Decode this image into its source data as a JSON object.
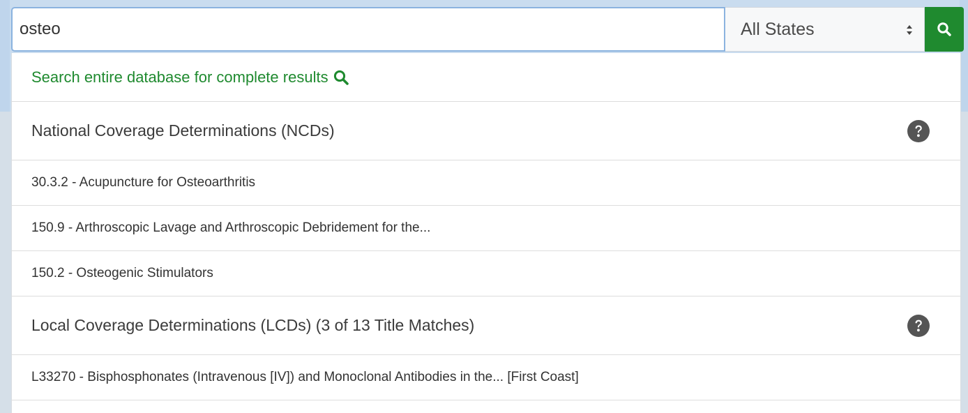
{
  "search": {
    "query": "osteo",
    "state_selected": "All States",
    "search_button_icon": "search-icon"
  },
  "dropdown": {
    "full_search_label": "Search entire database for complete results",
    "sections": [
      {
        "header": "National Coverage Determinations (NCDs)",
        "help_icon": "question-circle-icon",
        "items": [
          "30.3.2 - Acupuncture for Osteoarthritis",
          "150.9 - Arthroscopic Lavage and Arthroscopic Debridement for the...",
          "150.2 - Osteogenic Stimulators"
        ]
      },
      {
        "header": "Local Coverage Determinations (LCDs) (3 of 13 Title Matches)",
        "help_icon": "question-circle-icon",
        "items": [
          "L33270 - Bisphosphonates (Intravenous [IV]) and Monoclonal Antibodies in the... [First Coast]"
        ]
      }
    ]
  },
  "colors": {
    "accent_green": "#1f8a2f",
    "input_border": "#8bb3df",
    "page_background": "#c9dcef",
    "help_icon": "#555555"
  }
}
